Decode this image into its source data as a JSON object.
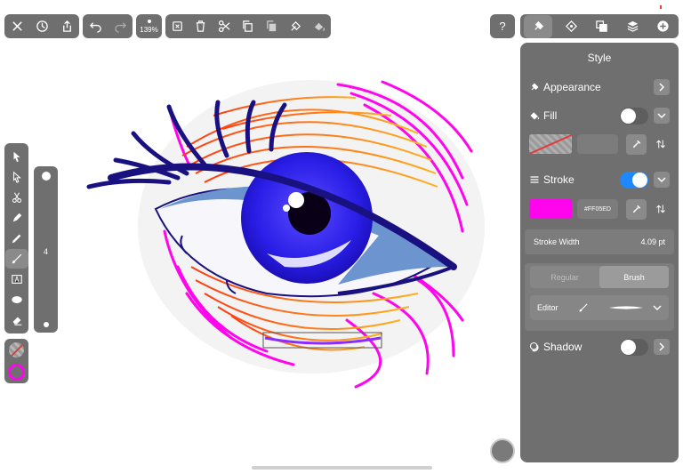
{
  "top_toolbar": {
    "zoom": "139%"
  },
  "layer_bar": {
    "value": "4"
  },
  "panel": {
    "title": "Style",
    "appearance_label": "Appearance",
    "fill_label": "Fill",
    "stroke_label": "Stroke",
    "stroke_hex": "#FF05ED",
    "stroke_width_label": "Stroke Width",
    "stroke_width_value": "4.09 pt",
    "mode_regular": "Regular",
    "mode_brush": "Brush",
    "editor_label": "Editor",
    "shadow_label": "Shadow"
  },
  "state": {
    "fill_enabled": false,
    "stroke_enabled": true,
    "shadow_enabled": false,
    "selected_mode": "Brush"
  },
  "colors": {
    "stroke_color": "#FF05ED",
    "accent": "#1E88FF",
    "panel_bg": "#6F6F6F"
  },
  "icons": {
    "top_left": [
      "close-icon",
      "history-icon",
      "share-icon"
    ],
    "history": [
      "undo-icon",
      "redo-icon"
    ],
    "edit": [
      "deselect-icon",
      "trash-icon",
      "scissors-icon",
      "copy-icon",
      "paste-icon",
      "style-copy-icon",
      "style-paste-icon"
    ],
    "right_tabs": [
      "brush-style-icon",
      "arrange-icon",
      "pathfinder-icon",
      "layers-icon",
      "add-icon"
    ],
    "tools": [
      "selection-arrow-icon",
      "direct-select-icon",
      "scissors-tool-icon",
      "pen-icon",
      "pencil-icon",
      "brush-icon",
      "text-icon",
      "ellipse-icon",
      "eraser-icon"
    ]
  }
}
